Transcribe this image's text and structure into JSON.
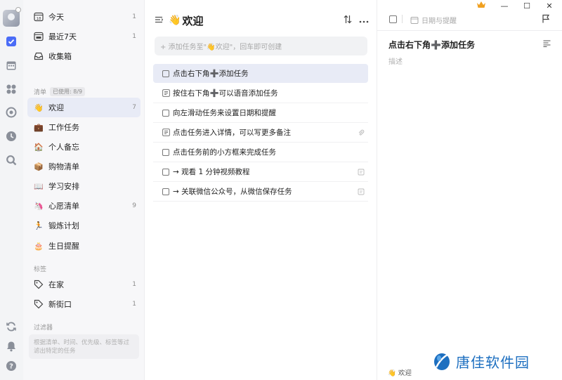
{
  "sidebar": {
    "smart": [
      {
        "label": "今天",
        "count": "1",
        "day": "18"
      },
      {
        "label": "最近7天",
        "count": "1"
      },
      {
        "label": "收集箱",
        "count": ""
      }
    ],
    "lists_title": "清单",
    "lists_used": "已使用: 8/9",
    "lists": [
      {
        "emoji": "👋",
        "label": "欢迎",
        "count": "7"
      },
      {
        "emoji": "💼",
        "label": "工作任务",
        "count": ""
      },
      {
        "emoji": "🏠",
        "label": "个人备忘",
        "count": ""
      },
      {
        "emoji": "📦",
        "label": "购物清单",
        "count": ""
      },
      {
        "emoji": "📖",
        "label": "学习安排",
        "count": ""
      },
      {
        "emoji": "🦄",
        "label": "心愿清单",
        "count": "9"
      },
      {
        "emoji": "🏃",
        "label": "锻炼计划",
        "count": ""
      },
      {
        "emoji": "🎂",
        "label": "生日提醒",
        "count": ""
      }
    ],
    "tags_title": "标签",
    "tags": [
      {
        "label": "在家",
        "count": "1"
      },
      {
        "label": "新街口",
        "count": "1"
      }
    ],
    "filters_title": "过滤器",
    "filters_hint": "根据清单、时间、优先级、标签等过滤出特定的任务"
  },
  "list": {
    "emoji": "👋",
    "title": "欢迎",
    "add_placeholder": "+ 添加任务至\"👋欢迎\"，回车即可创建",
    "tasks": [
      {
        "title": "点击右下角➕添加任务",
        "icon": "checkbox",
        "trail": ""
      },
      {
        "title": "按住右下角➕可以语音添加任务",
        "icon": "doc",
        "trail": ""
      },
      {
        "title": "向左滑动任务来设置日期和提醒",
        "icon": "checkbox",
        "trail": ""
      },
      {
        "title": "点击任务进入详情，可以写更多备注",
        "icon": "doc",
        "trail": "attachment"
      },
      {
        "title": "点击任务前的小方框来完成任务",
        "icon": "checkbox",
        "trail": ""
      },
      {
        "title": "→ 观看 1 分钟视频教程",
        "icon": "checkbox",
        "trail": "note"
      },
      {
        "title": "→ 关联微信公众号，从微信保存任务",
        "icon": "checkbox",
        "trail": "note"
      }
    ]
  },
  "detail": {
    "date_label": "日期与提醒",
    "title": "点击右下角➕添加任务",
    "description_placeholder": "描述",
    "footer_list": "👋 欢迎"
  },
  "window": {
    "minimize": "—",
    "maximize": "☐",
    "close": "✕"
  },
  "watermark": "唐佳软件园",
  "colors": {
    "accent": "#4a6cf7",
    "active_bg": "#e8ebf6",
    "crown": "#f0a020"
  }
}
